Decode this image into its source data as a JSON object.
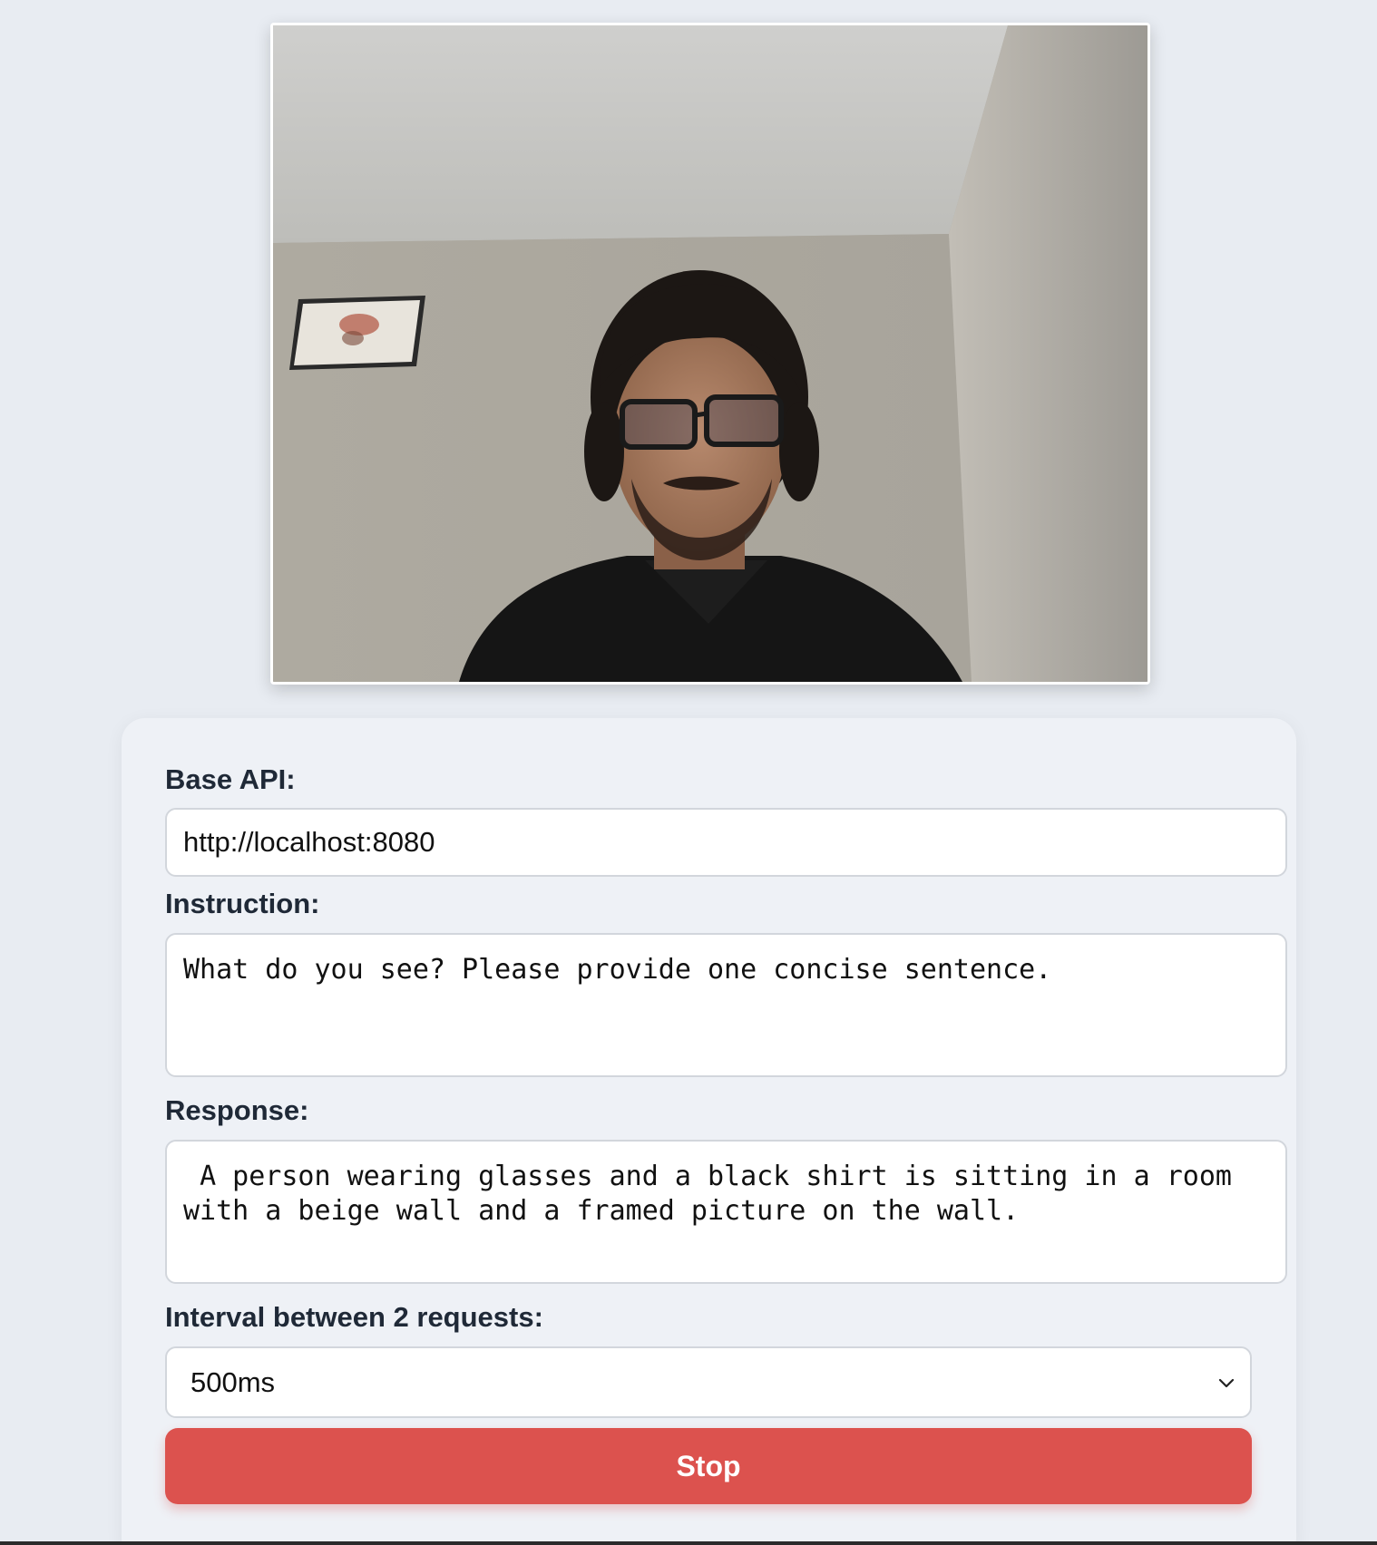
{
  "video": {
    "description_icon": "webcam-feed"
  },
  "form": {
    "base_api_label": "Base API:",
    "base_api_value": "http://localhost:8080",
    "instruction_label": "Instruction:",
    "instruction_value": "What do you see? Please provide one concise sentence.",
    "response_label": "Response:",
    "response_value": " A person wearing glasses and a black shirt is sitting in a room with a beige wall and a framed picture on the wall.",
    "interval_label": "Interval between 2 requests:",
    "interval_selected": "500ms",
    "stop_button_label": "Stop"
  },
  "colors": {
    "background": "#e8ecf2",
    "panel": "#eef1f6",
    "stop_button": "#dc524e",
    "label_text": "#1f2937"
  }
}
